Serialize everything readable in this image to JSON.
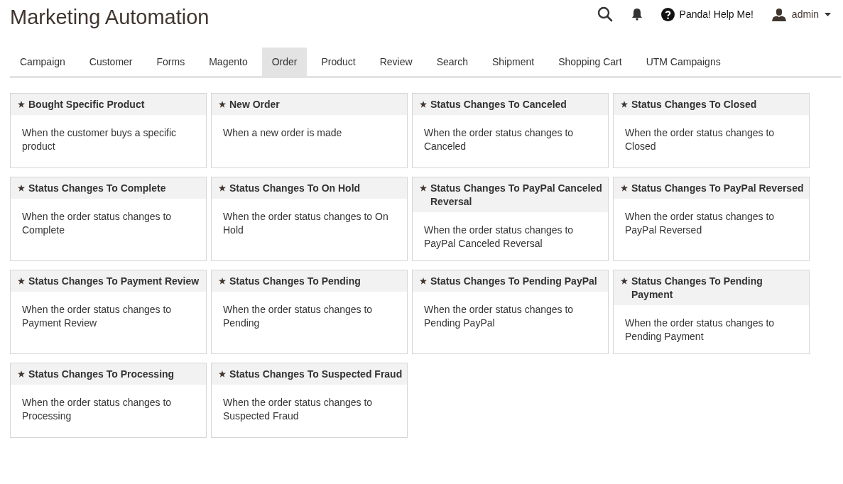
{
  "page_title": "Marketing Automation",
  "header": {
    "help_label": "Panda! Help Me!",
    "user_name": "admin"
  },
  "tabs": [
    {
      "label": "Campaign",
      "selected": false
    },
    {
      "label": "Customer",
      "selected": false
    },
    {
      "label": "Forms",
      "selected": false
    },
    {
      "label": "Magento",
      "selected": false
    },
    {
      "label": "Order",
      "selected": true
    },
    {
      "label": "Product",
      "selected": false
    },
    {
      "label": "Review",
      "selected": false
    },
    {
      "label": "Search",
      "selected": false
    },
    {
      "label": "Shipment",
      "selected": false
    },
    {
      "label": "Shopping Cart",
      "selected": false
    },
    {
      "label": "UTM Campaigns",
      "selected": false
    }
  ],
  "cards": [
    {
      "title": "Bought Specific Product",
      "description": "When the customer buys a specific product"
    },
    {
      "title": "New Order",
      "description": "When a new order is made"
    },
    {
      "title": "Status Changes To Canceled",
      "description": "When the order status changes to Canceled"
    },
    {
      "title": "Status Changes To Closed",
      "description": "When the order status changes to Closed"
    },
    {
      "title": "Status Changes To Complete",
      "description": "When the order status changes to Complete"
    },
    {
      "title": "Status Changes To On Hold",
      "description": "When the order status changes to On Hold"
    },
    {
      "title": "Status Changes To PayPal Canceled Reversal",
      "description": "When the order status changes to PayPal Canceled Reversal"
    },
    {
      "title": "Status Changes To PayPal Reversed",
      "description": "When the order status changes to PayPal Reversed"
    },
    {
      "title": "Status Changes To Payment Review",
      "description": "When the order status changes to Payment Review"
    },
    {
      "title": "Status Changes To Pending",
      "description": "When the order status changes to Pending"
    },
    {
      "title": "Status Changes To Pending PayPal",
      "description": "When the order status changes to Pending PayPal"
    },
    {
      "title": "Status Changes To Pending Payment",
      "description": "When the order status changes to Pending Payment"
    },
    {
      "title": "Status Changes To Processing",
      "description": "When the order status changes to Processing"
    },
    {
      "title": "Status Changes To Suspected Fraud",
      "description": "When the order status changes to Suspected Fraud"
    }
  ]
}
